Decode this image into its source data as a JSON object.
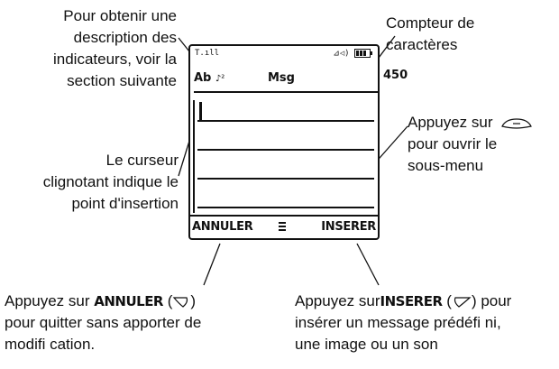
{
  "callouts": {
    "indicators": [
      "Pour obtenir une",
      "description des",
      "indicateurs, voir la",
      "section suivante"
    ],
    "counter": [
      "Compteur de",
      "caractères"
    ],
    "submenu": [
      "Appuyez sur",
      "pour ouvrir le",
      "sous-menu"
    ],
    "cursor": [
      "Le curseur",
      "clignotant indique le",
      "point d'insertion"
    ],
    "cancel": {
      "line1_pre": "Appuyez sur ",
      "line1_key": "ANNULER",
      "line1_post": " (",
      "line1_end": ")",
      "line2": "pour quitter sans apporter de",
      "line3": "modifi cation."
    },
    "insert": {
      "line1_pre": "Appuyez sur",
      "line1_key": "INSERER",
      "line1_post": " (",
      "line1_end": ") pour",
      "line2": "insérer un message prédéfi ni,",
      "line3": "une image ou un son"
    }
  },
  "screen": {
    "signal_label": "T.ıll",
    "status_right": "⊿◁)",
    "mode": "Ab",
    "mode_icon": "♪²",
    "title": "Msg",
    "char_count": "450",
    "softkey_left": "ANNULER",
    "softkey_right": "INSERER",
    "menu_icon": "menu-icon"
  }
}
